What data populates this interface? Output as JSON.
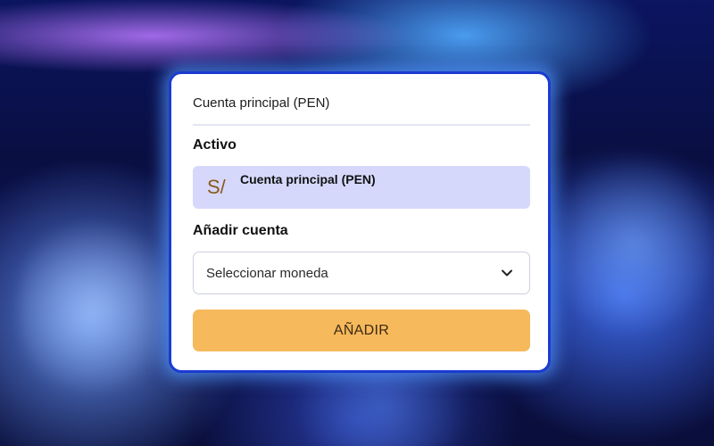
{
  "tabs": {
    "active_label": "Cuenta principal (PEN)"
  },
  "active_section": {
    "heading": "Activo",
    "account": {
      "currency_symbol": "S/",
      "name": "Cuenta principal (PEN)"
    }
  },
  "add_section": {
    "heading": "Añadir cuenta",
    "currency_select": {
      "value": "Seleccionar moneda",
      "icon": "chevron-down-icon"
    },
    "button_label": "AÑADIR"
  },
  "colors": {
    "card_border": "#1a3bd1",
    "account_row_bg": "#d6d8fb",
    "button_bg": "#f6b95c",
    "currency_symbol": "#8a5a1f"
  }
}
